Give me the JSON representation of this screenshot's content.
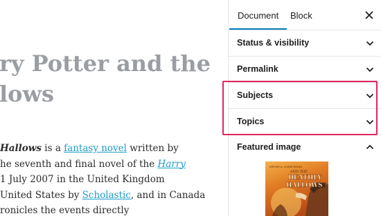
{
  "editor": {
    "title_lines": [
      "ry Potter and the",
      "lows"
    ],
    "paragraph": {
      "line1": {
        "italic": "Hallows",
        "text1": " is a ",
        "link": "fantasy novel",
        "text2": " written by"
      },
      "line2": {
        "text1": "he seventh and final novel of the ",
        "link": "Harry"
      },
      "line3": {
        "text1": "1 July 2007 in the United Kingdom"
      },
      "line4": {
        "text1": " United States by ",
        "link": "Scholastic",
        "text2": ", and in Canada"
      },
      "line5": {
        "text1": "ronicles the events directly"
      }
    }
  },
  "sidebar": {
    "tabs": {
      "document": "Document",
      "block": "Block"
    },
    "close_icon": "close-icon",
    "panels": {
      "status": "Status & visibility",
      "permalink": "Permalink",
      "subjects": "Subjects",
      "topics": "Topics",
      "featured": "Featured image"
    },
    "featured_image": {
      "publisher": "ARTHUR A. LEVINE BOOKS",
      "series": "AND THE",
      "title_line1": "DEATHLY",
      "title_line2": "HALLOWS"
    }
  },
  "colors": {
    "accent": "#007cba",
    "highlight": "#e0245e",
    "link": "#1c9cc7",
    "title_gray": "#9a9ea3"
  }
}
